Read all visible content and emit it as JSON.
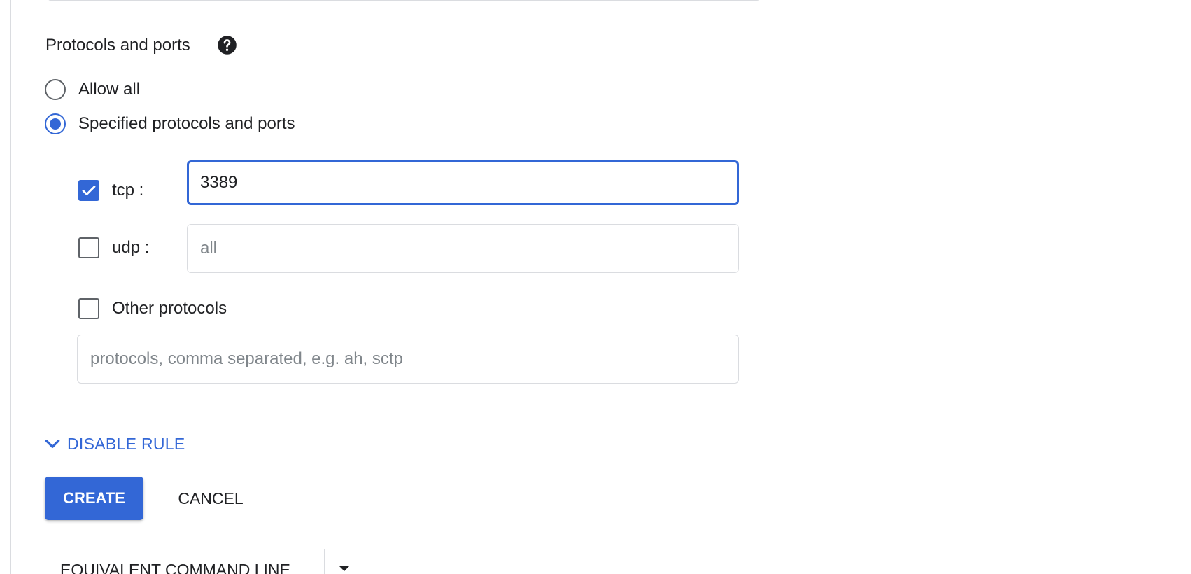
{
  "protocols_section": {
    "title": "Protocols and ports",
    "help_icon": "help-circle-icon"
  },
  "traffic_options": [
    {
      "label": "Allow all",
      "selected": false
    },
    {
      "label": "Specified protocols and ports",
      "selected": true
    }
  ],
  "tcp": {
    "label": "tcp :",
    "checked": true,
    "value": "3389"
  },
  "udp": {
    "label": "udp :",
    "checked": false,
    "placeholder": "all"
  },
  "other_protocols": {
    "label": "Other protocols",
    "checked": false,
    "placeholder": "protocols, comma separated, e.g. ah, sctp"
  },
  "disable_rule": {
    "label": "DISABLE RULE",
    "icon": "chevron-down-icon"
  },
  "actions": {
    "create_label": "CREATE",
    "cancel_label": "CANCEL"
  },
  "command_line": {
    "label": "EQUIVALENT COMMAND LINE",
    "dropdown_icon": "arrow-drop-down-icon"
  },
  "colors": {
    "accent": "#3367d6",
    "text": "#202124",
    "border": "#dadce0",
    "placeholder": "#80868b"
  }
}
